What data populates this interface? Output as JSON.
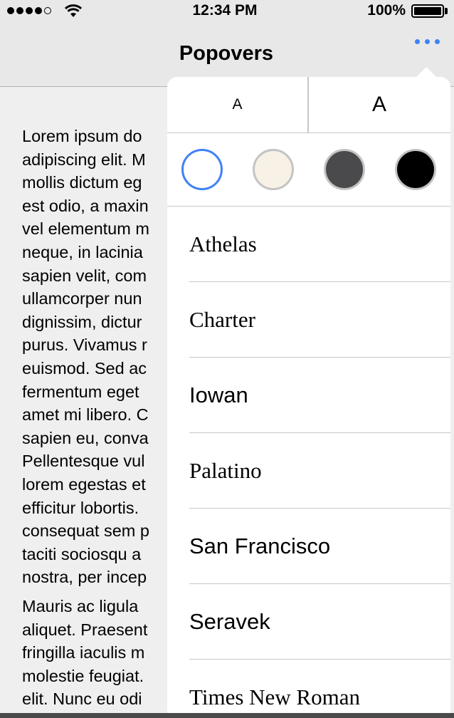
{
  "status_bar": {
    "time": "12:34 PM",
    "battery_percent": "100%",
    "signal_bars_filled": 4,
    "signal_bars_total": 5,
    "battery_level": 1.0,
    "icons": [
      "signal-dots-icon",
      "wifi-icon",
      "battery-icon"
    ]
  },
  "nav": {
    "title": "Popovers",
    "more_icon": "ellipsis-icon",
    "accent_color": "#3f82f5"
  },
  "body": {
    "paragraph1": [
      "Lorem ipsum do",
      "adipiscing elit. M",
      "mollis dictum eg",
      "est odio, a maxin",
      "vel elementum m",
      "neque, in lacinia",
      "sapien velit, com",
      "ullamcorper nun",
      "dignissim, dictur",
      "purus. Vivamus r",
      "euismod. Sed ac",
      "fermentum eget",
      "amet mi libero. C",
      "sapien eu, conva",
      "Pellentesque vul",
      "lorem egestas et",
      "efficitur lobortis.",
      "consequat sem p",
      "taciti sociosqu a",
      "nostra, per incep"
    ],
    "paragraph2": [
      "Mauris ac ligula",
      "aliquet. Praesent",
      "fringilla iaculis m",
      "molestie feugiat.",
      "elit. Nunc eu odi"
    ]
  },
  "popover": {
    "size_small_label": "A",
    "size_large_label": "A",
    "themes": [
      {
        "name": "white",
        "color": "#ffffff",
        "selected": true
      },
      {
        "name": "sepia",
        "color": "#f8f1e6",
        "selected": false
      },
      {
        "name": "gray",
        "color": "#4a4a4d",
        "selected": false
      },
      {
        "name": "night",
        "color": "#000000",
        "selected": false
      }
    ],
    "selected_border_color": "#3f82f5",
    "fonts": [
      "Athelas",
      "Charter",
      "Iowan",
      "Palatino",
      "San Francisco",
      "Seravek",
      "Times New Roman"
    ]
  }
}
